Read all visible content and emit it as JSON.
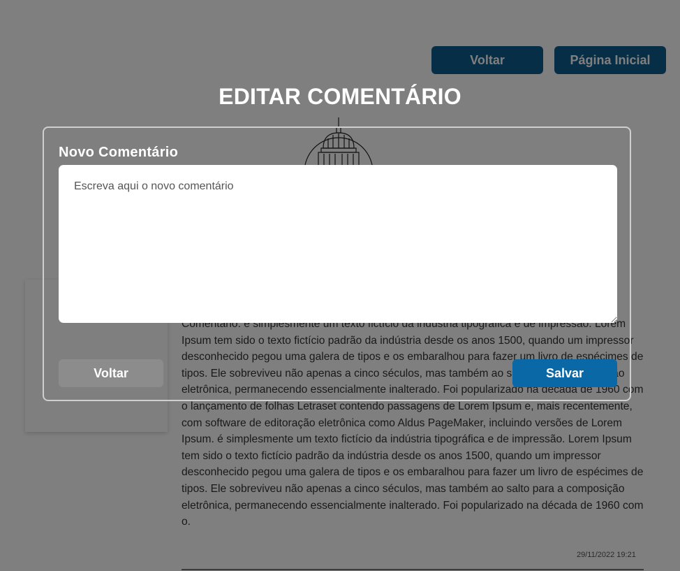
{
  "background": {
    "back_label": "Voltar",
    "home_label": "Página Inicial",
    "comment_text": "Comentário: é simplesmente um texto fictício da indústria tipográfica e de impressão. Lorem Ipsum tem sido o texto fictício padrão da indústria desde os anos 1500, quando um impressor desconhecido pegou uma galera de tipos e os embaralhou para fazer um livro de espécimes de tipos. Ele sobreviveu não apenas a cinco séculos, mas também ao salto para a composição eletrônica, permanecendo essencialmente inalterado. Foi popularizado na década de 1960 com o lançamento de folhas Letraset contendo passagens de Lorem Ipsum e, mais recentemente, com software de editoração eletrônica como Aldus PageMaker, incluindo versões de Lorem Ipsum. é simplesmente um texto fictício da indústria tipográfica e de impressão. Lorem Ipsum tem sido o texto fictício padrão da indústria desde os anos 1500, quando um impressor desconhecido pegou uma galera de tipos e os embaralhou para fazer um livro de espécimes de tipos. Ele sobreviveu não apenas a cinco séculos, mas também ao salto para a composição eletrônica, permanecendo essencialmente inalterado. Foi popularizado na década de 1960 com o.",
    "comment_date": "29/11/2022 19:21"
  },
  "modal": {
    "title": "EDITAR COMENTÁRIO",
    "field_label": "Novo Comentário",
    "textarea_placeholder": "Escreva aqui o novo comentário",
    "textarea_value": "",
    "back_label": "Voltar",
    "save_label": "Salvar"
  },
  "colors": {
    "primary": "#0b68a6",
    "secondary": "#8c8c8c",
    "overlay": "rgba(0,0,0,0.5)"
  }
}
